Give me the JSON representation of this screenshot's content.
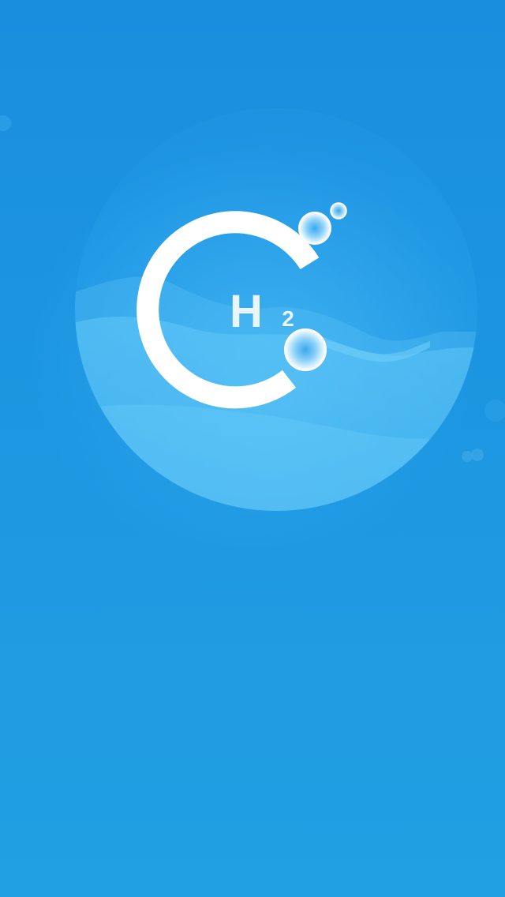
{
  "splash": {
    "logo": {
      "element_symbol": "H",
      "subscript": "2",
      "icon": "hydrogen-molecule-logo-icon"
    }
  },
  "colors": {
    "background_top": "#1a8ede",
    "background_bottom": "#21a0e3",
    "sphere_light": "#5cc6f7",
    "logo_ring": "#ffffff",
    "logo_text": "#e9f6ff",
    "bubble_core": "#3aa8ee"
  }
}
